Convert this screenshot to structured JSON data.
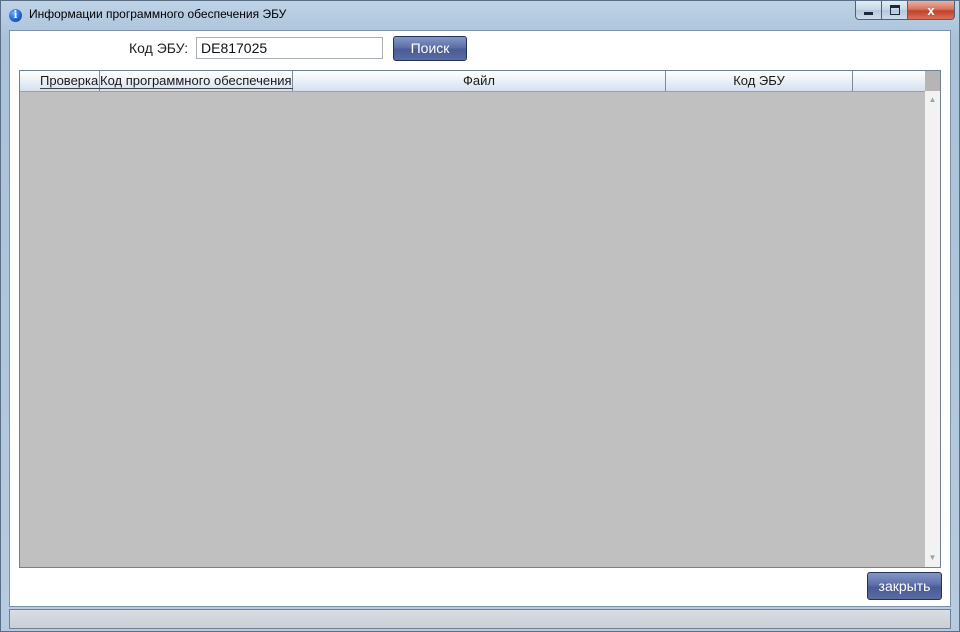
{
  "window": {
    "title": "Информации программного обеспечения ЭБУ",
    "icon": "info-icon"
  },
  "caption_buttons": {
    "minimize": "minimize-icon",
    "maximize": "maximize-icon",
    "close_glyph": "x"
  },
  "search": {
    "label": "Код ЭБУ:",
    "value": "DE817025",
    "button_label": "Поиск"
  },
  "grid": {
    "columns": [
      "Проверка",
      "Код программного обеспечения",
      "Файл",
      "Код ЭБУ",
      ""
    ],
    "rows": []
  },
  "footer": {
    "close_label": "закрыть"
  },
  "colors": {
    "button_blue": "#5d6fa8",
    "grid_background": "#c0c0c0"
  }
}
